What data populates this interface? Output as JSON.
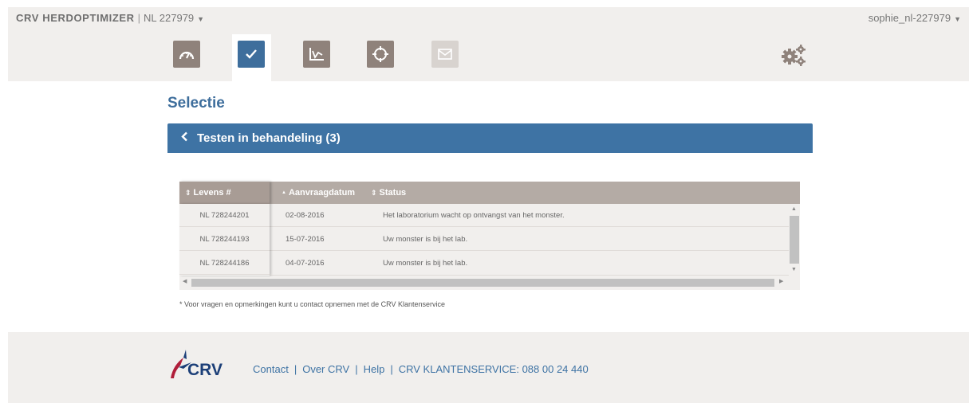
{
  "header": {
    "app_name": "CRV HERDOPTIMIZER",
    "herd_id": "NL 227979",
    "user": "sophie_nl-227979"
  },
  "nav": {
    "icons": [
      {
        "name": "dashboard-icon",
        "state": "inactive"
      },
      {
        "name": "checkmark-icon",
        "state": "active"
      },
      {
        "name": "chart-icon",
        "state": "inactive"
      },
      {
        "name": "target-icon",
        "state": "inactive"
      },
      {
        "name": "mail-icon",
        "state": "disabled"
      }
    ],
    "settings_icon": "gears-icon"
  },
  "page": {
    "title": "Selectie"
  },
  "bar": {
    "label": "Testen in behandeling (3)"
  },
  "table": {
    "columns": [
      "Levens #",
      "Aanvraagdatum",
      "Status"
    ],
    "rows": [
      {
        "id": "NL 728244201",
        "date": "02-08-2016",
        "status": "Het laboratorium wacht op ontvangst van het monster."
      },
      {
        "id": "NL 728244193",
        "date": "15-07-2016",
        "status": "Uw monster is bij het lab."
      },
      {
        "id": "NL 728244186",
        "date": "04-07-2016",
        "status": "Uw monster is bij het lab."
      }
    ]
  },
  "note": "* Voor vragen en opmerkingen kunt u contact opnemen met de CRV Klantenservice",
  "footer": {
    "logo_text": "CRV",
    "links": [
      "Contact",
      "Over CRV",
      "Help",
      "CRV KLANTENSERVICE: 088 00 24 440"
    ]
  },
  "colors": {
    "primary_blue": "#3e73a4",
    "nav_grey": "#8f827b",
    "table_header": "#b4aba5",
    "logo_red": "#b01e3a",
    "logo_navy": "#1c3f78"
  }
}
